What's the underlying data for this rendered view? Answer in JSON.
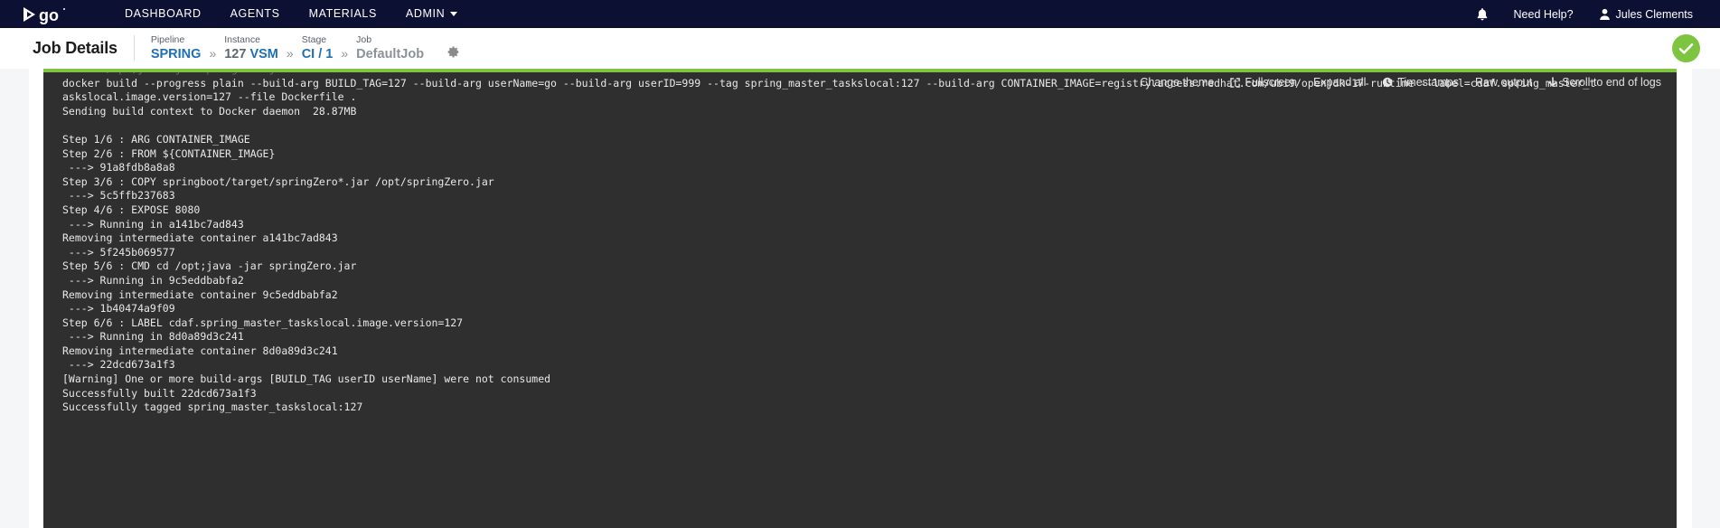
{
  "topnav": {
    "brand_name": "go-logo",
    "links": [
      {
        "label": "DASHBOARD",
        "name": "nav-dashboard"
      },
      {
        "label": "AGENTS",
        "name": "nav-agents"
      },
      {
        "label": "MATERIALS",
        "name": "nav-materials"
      },
      {
        "label": "ADMIN",
        "name": "nav-admin",
        "caret": true
      }
    ],
    "notifications_icon": "bell-icon",
    "help_label": "Need Help?",
    "user_name": "Jules Clements",
    "background": "#0c1134"
  },
  "pagehead": {
    "title": "Job Details",
    "breadcrumbs": [
      {
        "label": "Pipeline",
        "value": "SPRING",
        "style": "link"
      },
      {
        "label": "Instance",
        "value": "127 VSM",
        "style": "mixed",
        "value_a": "127 ",
        "value_b": "VSM"
      },
      {
        "label": "Stage",
        "value": "CI / 1",
        "style": "link"
      },
      {
        "label": "Job",
        "value": "DefaultJob",
        "style": "muted"
      }
    ],
    "separator": "»",
    "settings_icon": "gear-icon",
    "status": "passed",
    "status_icon": "check-icon",
    "status_color": "#7dc540"
  },
  "console": {
    "toolbar": [
      {
        "label": "Change theme",
        "name": "change-theme-button",
        "icon": null
      },
      {
        "label": "Fullscreen",
        "name": "fullscreen-button",
        "icon": "expand-icon"
      },
      {
        "label": "Expand all",
        "name": "expand-all-button",
        "icon": null
      },
      {
        "label": "Timestamps",
        "name": "timestamps-button",
        "icon": "clock-icon"
      },
      {
        "label": "Raw output",
        "name": "raw-output-button",
        "icon": null
      },
      {
        "label": "Scroll to end of logs",
        "name": "scroll-to-end-button",
        "icon": "arrow-down-icon"
      }
    ],
    "accent_color": "#7dc540",
    "background": "#2f2f2f",
    "clipped_line": "CMD cd /opt;java -jar springZero.jar",
    "lines": [
      "docker build --progress plain --build-arg BUILD_TAG=127 --build-arg userName=go --build-arg userID=999 --tag spring_master_taskslocal:127 --build-arg CONTAINER_IMAGE=registry.access.redhat.com/ubi9/openjdk-17-runtime --label=cdaf.spring_master_t",
      "askslocal.image.version=127 --file Dockerfile .",
      "Sending build context to Docker daemon  28.87MB",
      "",
      "Step 1/6 : ARG CONTAINER_IMAGE",
      "Step 2/6 : FROM ${CONTAINER_IMAGE}",
      " ---> 91a8fdb8a8a8",
      "Step 3/6 : COPY springboot/target/springZero*.jar /opt/springZero.jar",
      " ---> 5c5ffb237683",
      "Step 4/6 : EXPOSE 8080",
      " ---> Running in a141bc7ad843",
      "Removing intermediate container a141bc7ad843",
      " ---> 5f245b069577",
      "Step 5/6 : CMD cd /opt;java -jar springZero.jar",
      " ---> Running in 9c5eddbabfa2",
      "Removing intermediate container 9c5eddbabfa2",
      " ---> 1b40474a9f09",
      "Step 6/6 : LABEL cdaf.spring_master_taskslocal.image.version=127",
      " ---> Running in 8d0a89d3c241",
      "Removing intermediate container 8d0a89d3c241",
      " ---> 22dcd673a1f3",
      "[Warning] One or more build-args [BUILD_TAG userID userName] were not consumed",
      "Successfully built 22dcd673a1f3",
      "Successfully tagged spring_master_taskslocal:127"
    ]
  }
}
